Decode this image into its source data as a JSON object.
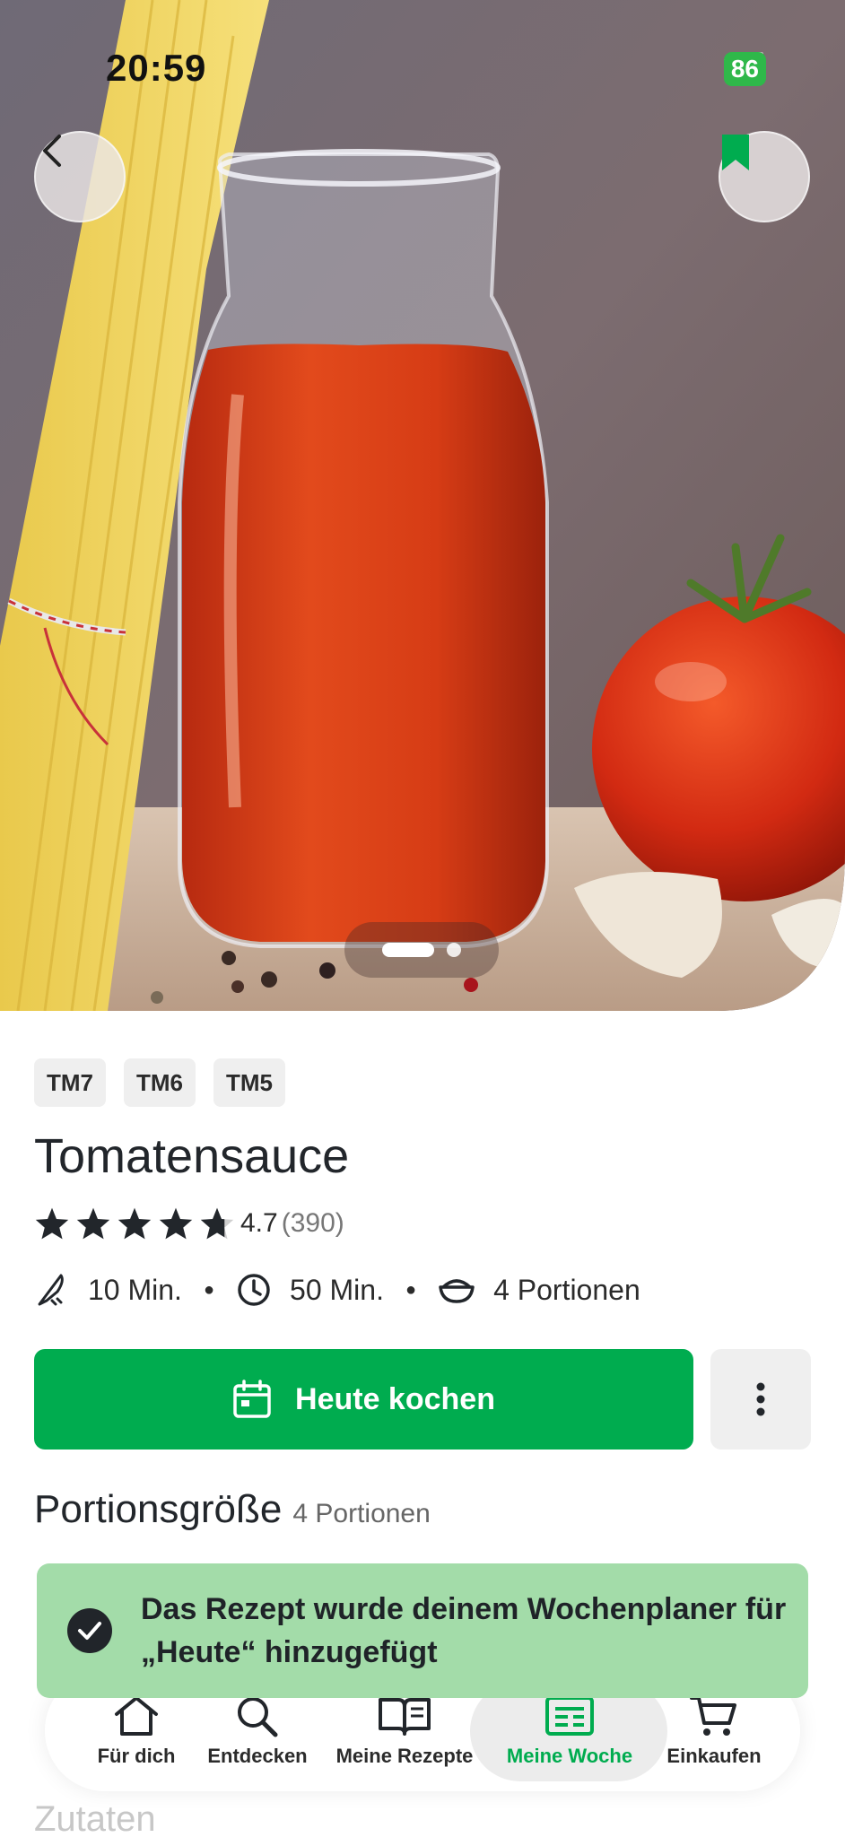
{
  "status_bar": {
    "time": "20:59",
    "battery": "86"
  },
  "hero": {
    "image_alt": "Tomatensauce in glass bottle with spaghetti and tomato",
    "page_count": 2,
    "active_page": 1
  },
  "chips": [
    "TM7",
    "TM6",
    "TM5"
  ],
  "recipe": {
    "title": "Tomatensauce",
    "rating_value": "4.7",
    "rating_count": "(390)",
    "stars": 4.7,
    "prep_time": "10 Min.",
    "total_time": "50 Min.",
    "portions": "4 Portionen"
  },
  "actions": {
    "cook_today_label": "Heute kochen"
  },
  "portions_section": {
    "title": "Portionsgröße",
    "value": "4 Portionen"
  },
  "toast": {
    "message": "Das Rezept wurde deinem Wochenplaner für „Heute“ hinzugefügt"
  },
  "ingredients_section": {
    "title": "Zutaten"
  },
  "nav": {
    "items": [
      {
        "label": "Für dich",
        "icon": "home-icon"
      },
      {
        "label": "Entdecken",
        "icon": "search-icon"
      },
      {
        "label": "Meine Rezepte",
        "icon": "book-icon"
      },
      {
        "label": "Meine Woche",
        "icon": "planner-icon",
        "active": true
      },
      {
        "label": "Einkaufen",
        "icon": "cart-icon"
      }
    ]
  },
  "colors": {
    "accent": "#00ac4f",
    "toast_bg": "#a3dca9",
    "chip_bg": "#efefef"
  }
}
